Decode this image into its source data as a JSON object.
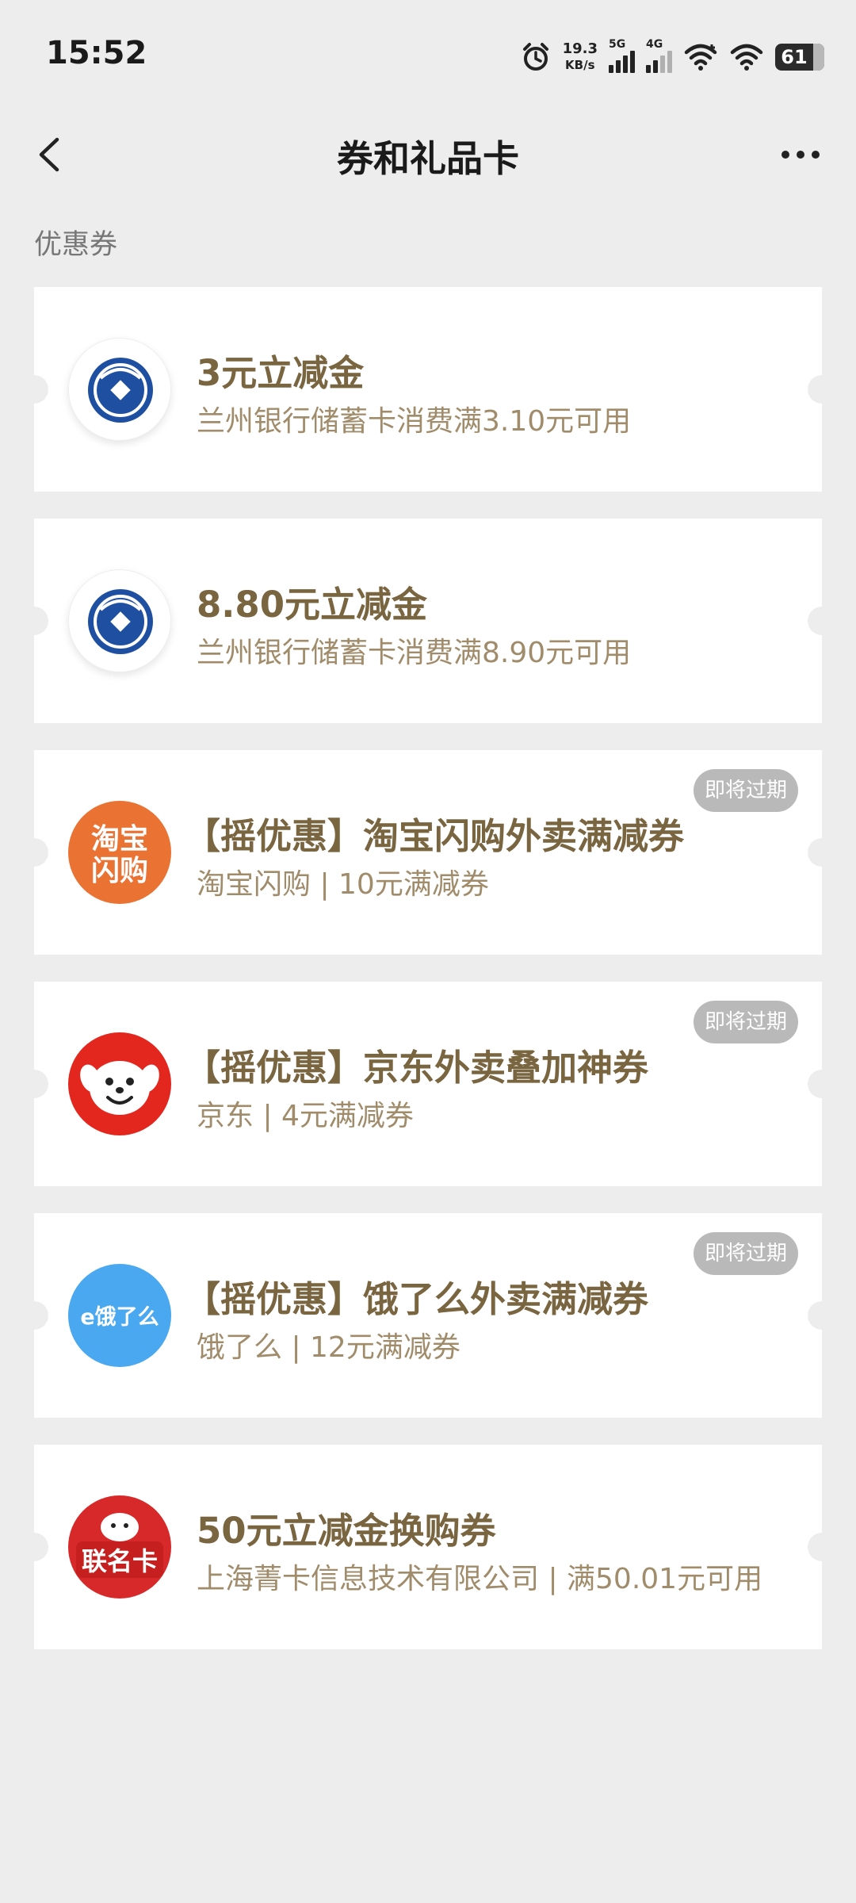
{
  "status_bar": {
    "time": "15:52",
    "net_speed_value": "19.3",
    "net_speed_unit": "KB/s",
    "signal1_label": "5G",
    "signal2_label": "4G",
    "battery": "61"
  },
  "nav": {
    "title": "券和礼品卡"
  },
  "section": {
    "title": "优惠券"
  },
  "coupons": [
    {
      "title": "3元立减金",
      "subtitle": "兰州银行储蓄卡消费满3.10元可用",
      "logo": "bank-of-lanzhou-logo",
      "badge": ""
    },
    {
      "title": "8.80元立减金",
      "subtitle": "兰州银行储蓄卡消费满8.90元可用",
      "logo": "bank-of-lanzhou-logo",
      "badge": ""
    },
    {
      "title": "【摇优惠】淘宝闪购外卖满减券",
      "subtitle": "淘宝闪购 | 10元满减券",
      "logo": "taobao-shangou-logo",
      "logo_text_1": "淘宝",
      "logo_text_2": "闪购",
      "badge": "即将过期"
    },
    {
      "title": "【摇优惠】京东外卖叠加神券",
      "subtitle": "京东 | 4元满减券",
      "logo": "jd-dog-logo",
      "badge": "即将过期"
    },
    {
      "title": "【摇优惠】饿了么外卖满减券",
      "subtitle": "饿了么 | 12元满减券",
      "logo": "eleme-logo",
      "logo_text": "饿了么",
      "badge": "即将过期"
    },
    {
      "title": "50元立减金换购券",
      "subtitle": "上海菁卡信息技术有限公司 | 满50.01元可用",
      "logo": "jd-union-card-logo",
      "logo_text": "联名卡",
      "badge": ""
    }
  ],
  "colors": {
    "background": "#ededed",
    "card": "#ffffff",
    "title": "#7a6541",
    "subtitle": "#a08c6b",
    "badge": "#b9b9b9"
  }
}
